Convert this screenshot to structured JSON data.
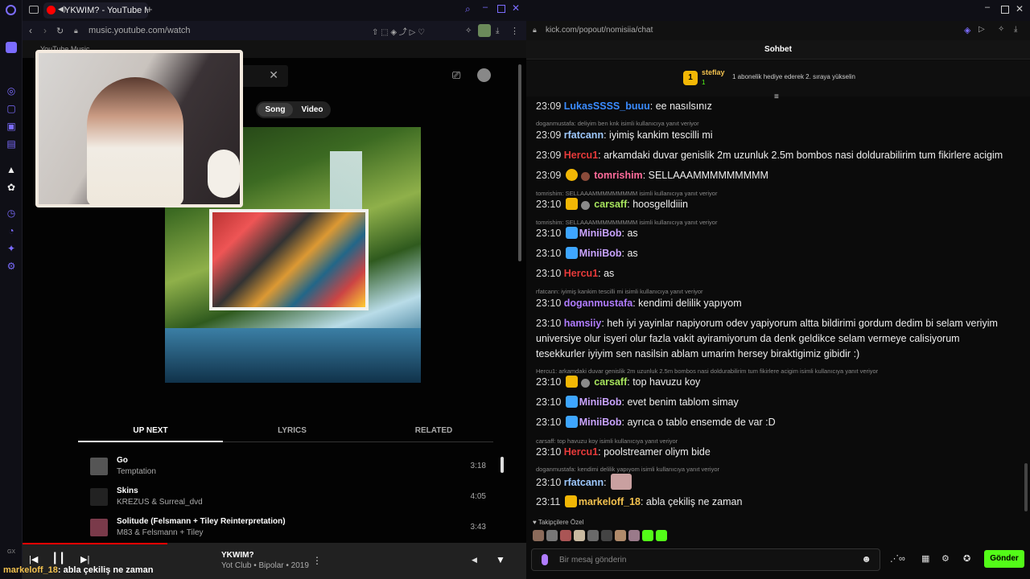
{
  "browser": {
    "yt_tab_title": "YKWIM? - YouTube Music",
    "yt_url": "music.youtube.com/watch",
    "yt_header": "YouTube Music",
    "kick_url": "kick.com/popout/nomisiia/chat"
  },
  "yt": {
    "toggle_song": "Song",
    "toggle_video": "Video",
    "tabs": [
      "UP NEXT",
      "LYRICS",
      "RELATED"
    ],
    "queue": [
      {
        "title": "Go",
        "artist": "Temptation",
        "duration": "3:18"
      },
      {
        "title": "Skins",
        "artist": "KREZUS & Surreal_dvd",
        "duration": "4:05"
      },
      {
        "title": "Solitude (Felsmann + Tiley Reinterpretation)",
        "artist": "M83 & Felsmann + Tiley",
        "duration": "3:43"
      }
    ],
    "now_playing": {
      "title": "YKWIM?",
      "meta": "Yot Club • Bipolar • 2019"
    }
  },
  "overlay_chat": {
    "user": "markeloff_18",
    "text": ": abla çekiliş ne zaman"
  },
  "kick": {
    "header": "Sohbet",
    "pin_rank": "1",
    "pin_user": "steflay",
    "pin_count": "1",
    "pin_text": "1 abonelik hediye ederek 2. sıraya yükselin",
    "reply1": "doganmustafa: deliyim ben knk isimli kullanıcıya yanıt veriyor",
    "reply2": "tomrishim: SELLAAAMMMMMMMMM isimli kullanıcıya yanıt veriyor",
    "reply3": "tomrishim: SELLAAAMMMMMMMMM isimli kullanıcıya yanıt veriyor",
    "reply4": "rfatcann: iyimiş kankim tescilli mi isimli kullanıcıya yanıt veriyor",
    "reply5": "Hercu1: arkamdaki duvar genislik 2m uzunluk 2.5m bombos nasi doldurabilirim tum fikirlere acigim isimli kullanıcıya yanıt veriyor",
    "reply6": "carsaff: top havuzu koy isimli kullanıcıya yanıt veriyor",
    "reply7": "doganmustafa: kendimi delilik yapıyom isimli kullanıcıya yanıt veriyor",
    "messages": [
      {
        "time": "23:09",
        "user": "LukasSSSS_buuu",
        "text": ": ee nasılsınız",
        "color": "#3b8cff"
      },
      {
        "time": "23:09",
        "user": "rfatcann",
        "text": ": iyimiş kankim tescilli mi",
        "color": "#9ec9ff"
      },
      {
        "time": "23:09",
        "user": "Hercu1",
        "text": ": arkamdaki duvar genislik 2m uzunluk 2.5m bombos nasi doldurabilirim tum fikirlere acigim",
        "color": "#e63a3a"
      },
      {
        "time": "23:09",
        "user": "tomrishim",
        "text": ": SELLAAAMMMMMMMMM",
        "color": "#ff6b9a"
      },
      {
        "time": "23:10",
        "user": "carsaff",
        "text": ": hoosgelldiiin",
        "color": "#a6e35c"
      },
      {
        "time": "23:10",
        "user": "MiniiBob",
        "text": ": as",
        "color": "#c9a3ff"
      },
      {
        "time": "23:10",
        "user": "MiniiBob",
        "text": ": as",
        "color": "#c9a3ff"
      },
      {
        "time": "23:10",
        "user": "Hercu1",
        "text": ": as",
        "color": "#e63a3a"
      },
      {
        "time": "23:10",
        "user": "doganmustafa",
        "text": ": kendimi delilik yapıyom",
        "color": "#b07cff"
      },
      {
        "time": "23:10",
        "user": "hamsiiy",
        "text": ": heh iyi yayinlar napiyorum odev yapiyorum altta bildirimi gordum dedim bi selam veriyim",
        "color": "#b07cff"
      },
      {
        "time": "23:10",
        "user": "carsaff",
        "text": ": top havuzu koy",
        "color": "#a6e35c"
      },
      {
        "time": "23:10",
        "user": "MiniiBob",
        "text": ": evet benim tablom simay",
        "color": "#c9a3ff"
      },
      {
        "time": "23:10",
        "user": "MiniiBob",
        "text": ": ayrıca o tablo ensemde de var :D",
        "color": "#c9a3ff"
      },
      {
        "time": "23:10",
        "user": "Hercu1",
        "text": ": poolstreamer oliym bide",
        "color": "#e63a3a"
      },
      {
        "time": "23:10",
        "user": "rfatcann",
        "text": ":",
        "color": "#9ec9ff"
      },
      {
        "time": "23:11",
        "user": "markeloff_18",
        "text": ": abla çekiliş ne zaman",
        "color": "#f2c14e"
      }
    ],
    "hamsi_line2": "universiye olur isyeri olur fazla vakit ayiramiyorum da denk geldikce selam vermeye calisiyorum",
    "hamsi_line3": "tesekkurler iyiyim sen nasilsin ablam umarim hersey biraktigimiz gibidir :)",
    "followers_label": "Takipçilere Özel",
    "composer_placeholder": "Bir mesaj gönderin",
    "send": "Gönder"
  },
  "colors": {
    "kick_green": "#53fc18",
    "yt_red": "#ff0000",
    "opera_purple": "#7b6cff"
  }
}
